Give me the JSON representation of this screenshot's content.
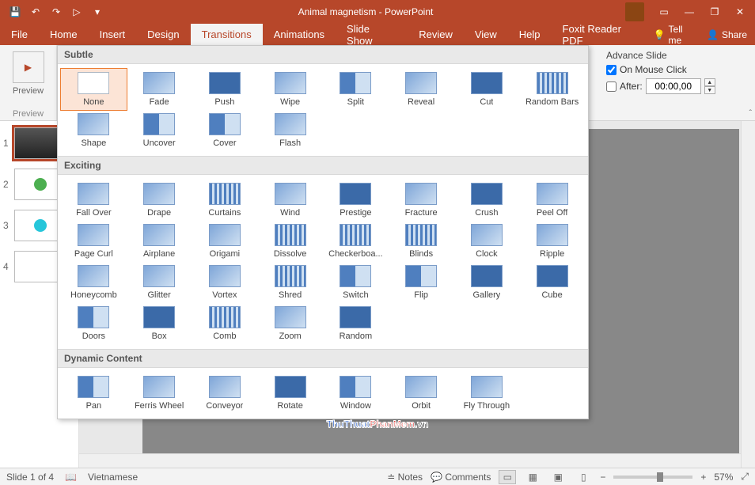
{
  "title": "Animal magnetism - PowerPoint",
  "qat": {
    "save": "💾",
    "undo": "↶",
    "redo": "↷",
    "start": "▷"
  },
  "window": {
    "ribbon_opts": "▭",
    "min": "—",
    "restore": "❐",
    "close": "✕"
  },
  "tabs": {
    "file": "File",
    "home": "Home",
    "insert": "Insert",
    "design": "Design",
    "transitions": "Transitions",
    "animations": "Animations",
    "slideshow": "Slide Show",
    "review": "Review",
    "view": "View",
    "help": "Help",
    "foxit": "Foxit Reader PDF",
    "tellme": "Tell me",
    "share": "Share"
  },
  "preview": {
    "btn": "Preview",
    "group": "Preview"
  },
  "advance": {
    "title": "Advance Slide",
    "on_mouse": "On Mouse Click",
    "on_mouse_checked": true,
    "after": "After:",
    "after_checked": false,
    "time": "00:00,00"
  },
  "collapse": "ˆ",
  "thumbs": [
    {
      "num": "1",
      "active": true,
      "kind": "dark"
    },
    {
      "num": "2",
      "active": false,
      "kind": "green"
    },
    {
      "num": "3",
      "active": false,
      "kind": "cyan"
    },
    {
      "num": "4",
      "active": false,
      "kind": "blank"
    }
  ],
  "gallery": {
    "sections": [
      {
        "header": "Subtle",
        "items": [
          {
            "label": "None",
            "sel": true,
            "cls": "g-none"
          },
          {
            "label": "Fade",
            "cls": "g-grad"
          },
          {
            "label": "Push",
            "cls": "g-dark"
          },
          {
            "label": "Wipe",
            "cls": "g-grad"
          },
          {
            "label": "Split",
            "cls": "g-split"
          },
          {
            "label": "Reveal",
            "cls": "g-grad"
          },
          {
            "label": "Cut",
            "cls": "g-dark"
          },
          {
            "label": "Random Bars",
            "cls": "g-bars"
          },
          {
            "label": "Shape",
            "cls": "g-grad"
          },
          {
            "label": "Uncover",
            "cls": "g-split"
          },
          {
            "label": "Cover",
            "cls": "g-split"
          },
          {
            "label": "Flash",
            "cls": "g-grad"
          }
        ]
      },
      {
        "header": "Exciting",
        "items": [
          {
            "label": "Fall Over",
            "cls": "g-grad"
          },
          {
            "label": "Drape",
            "cls": "g-grad"
          },
          {
            "label": "Curtains",
            "cls": "g-bars"
          },
          {
            "label": "Wind",
            "cls": "g-grad"
          },
          {
            "label": "Prestige",
            "cls": "g-dark"
          },
          {
            "label": "Fracture",
            "cls": "g-grad"
          },
          {
            "label": "Crush",
            "cls": "g-dark"
          },
          {
            "label": "Peel Off",
            "cls": "g-grad"
          },
          {
            "label": "Page Curl",
            "cls": "g-grad"
          },
          {
            "label": "Airplane",
            "cls": "g-grad"
          },
          {
            "label": "Origami",
            "cls": "g-grad"
          },
          {
            "label": "Dissolve",
            "cls": "g-bars"
          },
          {
            "label": "Checkerboa...",
            "cls": "g-bars"
          },
          {
            "label": "Blinds",
            "cls": "g-bars"
          },
          {
            "label": "Clock",
            "cls": "g-grad"
          },
          {
            "label": "Ripple",
            "cls": "g-grad"
          },
          {
            "label": "Honeycomb",
            "cls": "g-grad"
          },
          {
            "label": "Glitter",
            "cls": "g-grad"
          },
          {
            "label": "Vortex",
            "cls": "g-grad"
          },
          {
            "label": "Shred",
            "cls": "g-bars"
          },
          {
            "label": "Switch",
            "cls": "g-split"
          },
          {
            "label": "Flip",
            "cls": "g-split"
          },
          {
            "label": "Gallery",
            "cls": "g-dark"
          },
          {
            "label": "Cube",
            "cls": "g-dark"
          },
          {
            "label": "Doors",
            "cls": "g-split"
          },
          {
            "label": "Box",
            "cls": "g-dark"
          },
          {
            "label": "Comb",
            "cls": "g-bars"
          },
          {
            "label": "Zoom",
            "cls": "g-grad"
          },
          {
            "label": "Random",
            "cls": "g-dark"
          }
        ]
      },
      {
        "header": "Dynamic Content",
        "items": [
          {
            "label": "Pan",
            "cls": "g-split"
          },
          {
            "label": "Ferris Wheel",
            "cls": "g-grad"
          },
          {
            "label": "Conveyor",
            "cls": "g-grad"
          },
          {
            "label": "Rotate",
            "cls": "g-dark"
          },
          {
            "label": "Window",
            "cls": "g-split"
          },
          {
            "label": "Orbit",
            "cls": "g-grad"
          },
          {
            "label": "Fly Through",
            "cls": "g-grad"
          }
        ]
      }
    ]
  },
  "status": {
    "slide": "Slide 1 of 4",
    "lang": "Vietnamese",
    "notes": "Notes",
    "comments": "Comments",
    "zoom": "57%",
    "zoom_minus": "−",
    "zoom_plus": "+",
    "fit": "⤢"
  },
  "watermark": {
    "a": "ThuThuat",
    "b": "PhanMem",
    "c": ".vn"
  }
}
